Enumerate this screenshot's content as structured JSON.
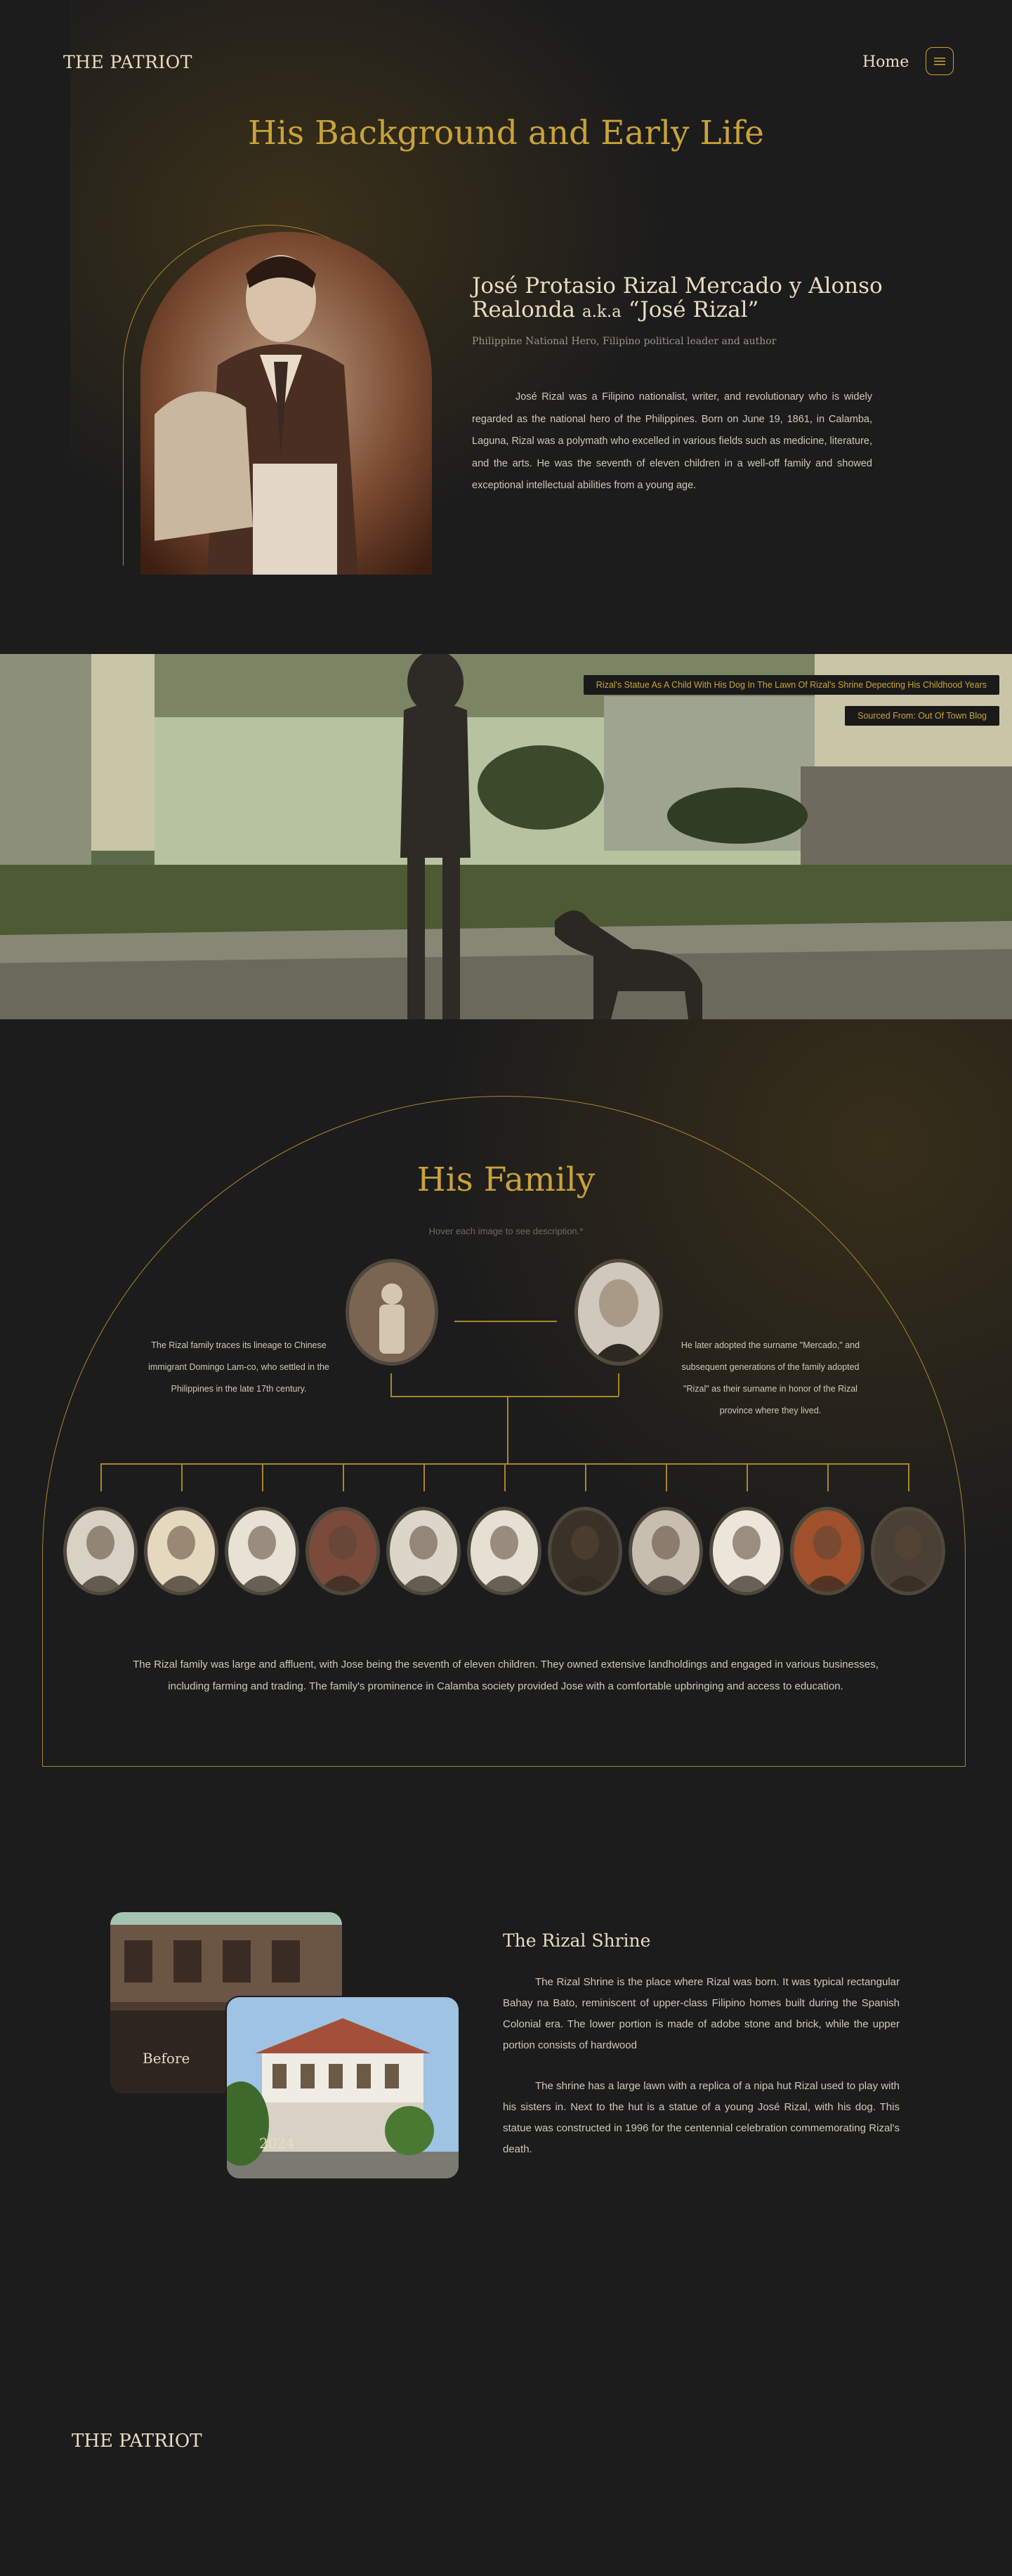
{
  "header": {
    "logo": "THE PATRIOT",
    "nav_home": "Home"
  },
  "background": {
    "title": "His Background and Early Life",
    "name": "José Protasio Rizal Mercado y Alonso Realonda",
    "aka": "a.k.a",
    "nickname": "“José Rizal”",
    "role": "Philippine National Hero, Filipino political leader and author",
    "paragraph": "José Rizal was a Filipino nationalist, writer, and revolutionary who is widely regarded as the national hero of the Philippines. Born on June 19, 1861, in Calamba, Laguna, Rizal was a polymath who excelled in various fields such as medicine, literature, and the arts. He was the seventh of eleven children in a well-off family and showed exceptional intellectual abilities from a young age."
  },
  "banner": {
    "caption_1": "Rizal's Statue As A Child With His Dog In The Lawn Of Rizal's Shrine Depecting His Childhood Years",
    "caption_2": "Sourced From: Out Of Town Blog"
  },
  "family": {
    "title": "His Family",
    "hint": "Hover each image to see description.*",
    "left_text": "The Rizal family traces its lineage to Chinese immigrant Domingo Lam-co, who settled in the Philippines in the late 17th century.",
    "right_text": "He later adopted the surname \"Mercado,\" and subsequent generations of the family adopted \"Rizal\" as their surname in honor of the Rizal province where they lived.",
    "children_count": 11,
    "summary": "The Rizal family was large and affluent, with Jose being the seventh of eleven children. They owned extensive landholdings and engaged in various businesses, including farming and trading. The family's prominence in Calamba society provided Jose with a comfortable upbringing and access to education."
  },
  "shrine": {
    "title": "The Rizal Shrine",
    "before_label": "Before",
    "after_label": "2024",
    "paragraph_1": "The Rizal Shrine is the place where Rizal was born. It was typical rectangular Bahay na Bato, reminiscent of upper-class Filipino homes built during the Spanish Colonial era. The lower portion is made of adobe stone and brick, while the upper portion consists of hardwood",
    "paragraph_2": "The shrine has a large lawn with a replica of a nipa hut Rizal used to play with his sisters in. Next to the hut is a statue of a young José Rizal, with his dog. This statue was constructed in 1996 for the centennial celebration commemorating Rizal's death."
  },
  "footer": {
    "logo": "THE PATRIOT"
  },
  "colors": {
    "accent": "#c9a23a",
    "background": "#1c1c1c",
    "text": "#d9d2c2"
  },
  "icons": {
    "menu": "menu-icon"
  }
}
